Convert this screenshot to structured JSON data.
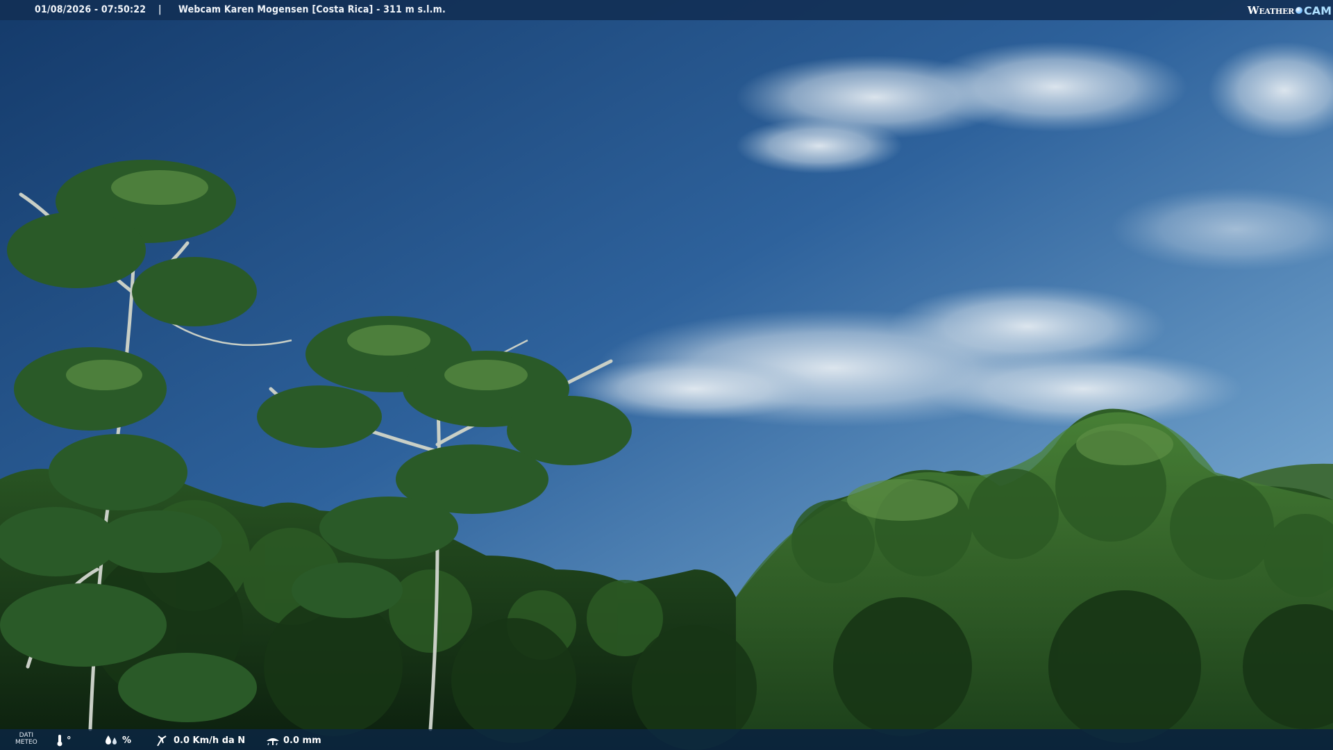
{
  "overlay": {
    "datetime": "01/08/2026 - 07:50:22",
    "separator": "|",
    "title": "Webcam Karen Mogensen [Costa Rica]  - 311 m s.l.m.",
    "logo": {
      "word": "Weather",
      "cam": "CAM",
      "dot_color": "#7fc4ff"
    }
  },
  "weather_bar": {
    "label_line1": "DATI",
    "label_line2": "METEO",
    "temperature": "°",
    "humidity": "%",
    "wind": "0.0 Km/h da N",
    "rain": "0.0 mm",
    "icons": [
      "thermometer-icon",
      "humidity-icon",
      "wind-icon",
      "rain-gauge-icon"
    ]
  },
  "colors": {
    "sky_top": "#1f4f87",
    "sky_horizon": "#8db6d8",
    "foliage": "#1f4a1e",
    "bar_background": "#123056"
  }
}
